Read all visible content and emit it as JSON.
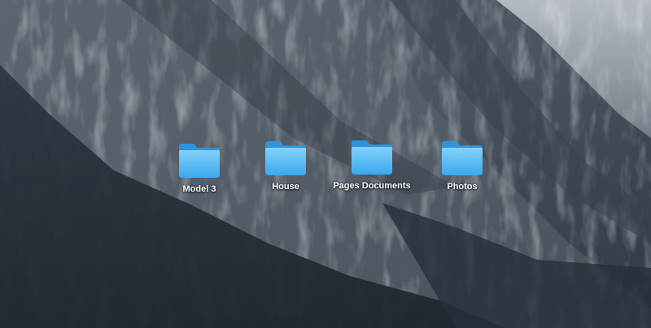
{
  "desktop": {
    "folders": [
      {
        "label": "Model 3",
        "icon": "folder-icon"
      },
      {
        "label": "House",
        "icon": "folder-icon"
      },
      {
        "label": "Pages Documents",
        "icon": "folder-icon"
      },
      {
        "label": "Photos",
        "icon": "folder-icon"
      }
    ]
  },
  "colors": {
    "folder_top": "#7fd0fb",
    "folder_bottom": "#3ba9f0",
    "folder_back": "#2f95de"
  }
}
